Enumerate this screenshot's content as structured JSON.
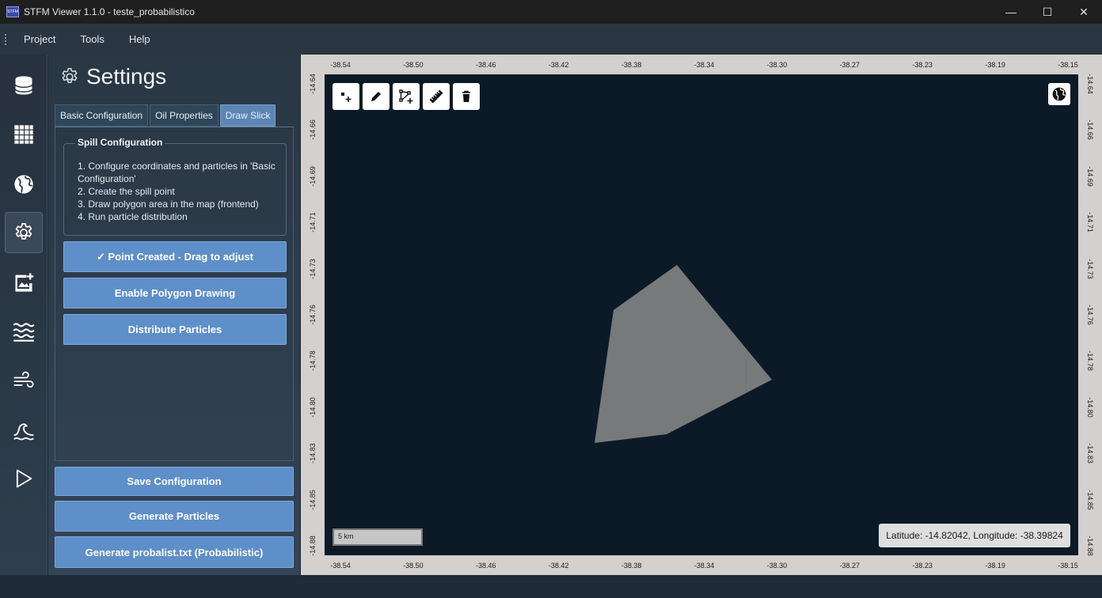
{
  "window": {
    "icon_text": "STFM",
    "title": "STFM Viewer 1.1.0 - teste_probabilistico",
    "minimize": "—",
    "maximize": "☐",
    "close": "✕"
  },
  "menu": [
    "Project",
    "Tools",
    "Help"
  ],
  "rail": [
    {
      "name": "database-icon"
    },
    {
      "name": "grid-icon"
    },
    {
      "name": "globe-icon"
    },
    {
      "name": "settings-gear-icon",
      "active": true
    },
    {
      "name": "add-image-icon"
    },
    {
      "name": "waves-icon"
    },
    {
      "name": "wind-icon"
    },
    {
      "name": "ocean-wave-icon"
    },
    {
      "name": "play-icon"
    }
  ],
  "settings": {
    "title": "Settings",
    "tabs": [
      {
        "label": "Basic Configuration",
        "active": false
      },
      {
        "label": "Oil Properties",
        "active": false
      },
      {
        "label": "Draw Slick",
        "active": true
      }
    ],
    "spill_group": {
      "title": "Spill Configuration",
      "lines": [
        "1. Configure coordinates and particles in 'Basic Configuration'",
        "2. Create the spill point",
        "3. Draw polygon area in the map (frontend)",
        "4. Run particle distribution"
      ]
    },
    "actions": {
      "point_created": "✓ Point Created - Drag to adjust",
      "enable_polygon": "Enable Polygon Drawing",
      "distribute": "Distribute Particles"
    },
    "footer": {
      "save": "Save Configuration",
      "generate": "Generate Particles",
      "probalist": "Generate probalist.txt (Probabilistic)"
    }
  },
  "map": {
    "x_ticks": [
      "-38.54",
      "-38.50",
      "-38.46",
      "-38.42",
      "-38.38",
      "-38.34",
      "-38.30",
      "-38.27",
      "-38.23",
      "-38.19",
      "-38.15"
    ],
    "y_ticks": [
      "-14.64",
      "-14.66",
      "-14.69",
      "-14.71",
      "-14.73",
      "-14.76",
      "-14.78",
      "-14.80",
      "-14.83",
      "-14.85",
      "-14.88"
    ],
    "tools": [
      "add-point-icon",
      "pencil-icon",
      "polygon-add-icon",
      "ruler-icon",
      "trash-icon"
    ],
    "scale_label": "5 km",
    "coords_text": "Latitude: -14.82042, Longitude: -38.39824",
    "background": "#0c1a27",
    "polygon_color": "#777a7b"
  }
}
